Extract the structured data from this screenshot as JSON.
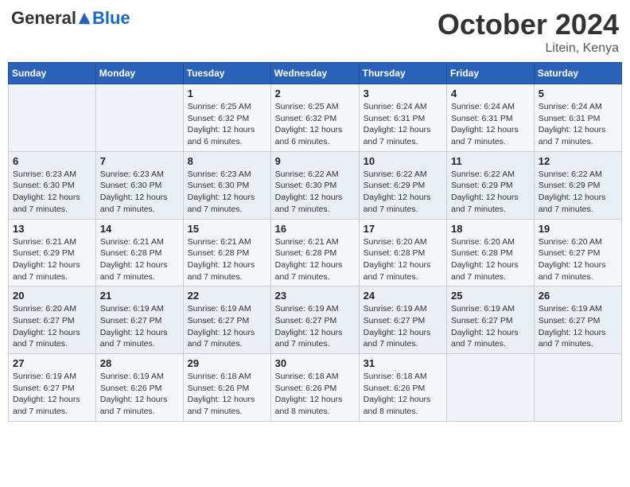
{
  "logo": {
    "general": "General",
    "blue": "Blue"
  },
  "title": {
    "month": "October 2024",
    "location": "Litein, Kenya"
  },
  "days_of_week": [
    "Sunday",
    "Monday",
    "Tuesday",
    "Wednesday",
    "Thursday",
    "Friday",
    "Saturday"
  ],
  "weeks": [
    [
      {
        "day": "",
        "detail": ""
      },
      {
        "day": "",
        "detail": ""
      },
      {
        "day": "1",
        "detail": "Sunrise: 6:25 AM\nSunset: 6:32 PM\nDaylight: 12 hours and 6 minutes."
      },
      {
        "day": "2",
        "detail": "Sunrise: 6:25 AM\nSunset: 6:32 PM\nDaylight: 12 hours and 6 minutes."
      },
      {
        "day": "3",
        "detail": "Sunrise: 6:24 AM\nSunset: 6:31 PM\nDaylight: 12 hours and 7 minutes."
      },
      {
        "day": "4",
        "detail": "Sunrise: 6:24 AM\nSunset: 6:31 PM\nDaylight: 12 hours and 7 minutes."
      },
      {
        "day": "5",
        "detail": "Sunrise: 6:24 AM\nSunset: 6:31 PM\nDaylight: 12 hours and 7 minutes."
      }
    ],
    [
      {
        "day": "6",
        "detail": "Sunrise: 6:23 AM\nSunset: 6:30 PM\nDaylight: 12 hours and 7 minutes."
      },
      {
        "day": "7",
        "detail": "Sunrise: 6:23 AM\nSunset: 6:30 PM\nDaylight: 12 hours and 7 minutes."
      },
      {
        "day": "8",
        "detail": "Sunrise: 6:23 AM\nSunset: 6:30 PM\nDaylight: 12 hours and 7 minutes."
      },
      {
        "day": "9",
        "detail": "Sunrise: 6:22 AM\nSunset: 6:30 PM\nDaylight: 12 hours and 7 minutes."
      },
      {
        "day": "10",
        "detail": "Sunrise: 6:22 AM\nSunset: 6:29 PM\nDaylight: 12 hours and 7 minutes."
      },
      {
        "day": "11",
        "detail": "Sunrise: 6:22 AM\nSunset: 6:29 PM\nDaylight: 12 hours and 7 minutes."
      },
      {
        "day": "12",
        "detail": "Sunrise: 6:22 AM\nSunset: 6:29 PM\nDaylight: 12 hours and 7 minutes."
      }
    ],
    [
      {
        "day": "13",
        "detail": "Sunrise: 6:21 AM\nSunset: 6:29 PM\nDaylight: 12 hours and 7 minutes."
      },
      {
        "day": "14",
        "detail": "Sunrise: 6:21 AM\nSunset: 6:28 PM\nDaylight: 12 hours and 7 minutes."
      },
      {
        "day": "15",
        "detail": "Sunrise: 6:21 AM\nSunset: 6:28 PM\nDaylight: 12 hours and 7 minutes."
      },
      {
        "day": "16",
        "detail": "Sunrise: 6:21 AM\nSunset: 6:28 PM\nDaylight: 12 hours and 7 minutes."
      },
      {
        "day": "17",
        "detail": "Sunrise: 6:20 AM\nSunset: 6:28 PM\nDaylight: 12 hours and 7 minutes."
      },
      {
        "day": "18",
        "detail": "Sunrise: 6:20 AM\nSunset: 6:28 PM\nDaylight: 12 hours and 7 minutes."
      },
      {
        "day": "19",
        "detail": "Sunrise: 6:20 AM\nSunset: 6:27 PM\nDaylight: 12 hours and 7 minutes."
      }
    ],
    [
      {
        "day": "20",
        "detail": "Sunrise: 6:20 AM\nSunset: 6:27 PM\nDaylight: 12 hours and 7 minutes."
      },
      {
        "day": "21",
        "detail": "Sunrise: 6:19 AM\nSunset: 6:27 PM\nDaylight: 12 hours and 7 minutes."
      },
      {
        "day": "22",
        "detail": "Sunrise: 6:19 AM\nSunset: 6:27 PM\nDaylight: 12 hours and 7 minutes."
      },
      {
        "day": "23",
        "detail": "Sunrise: 6:19 AM\nSunset: 6:27 PM\nDaylight: 12 hours and 7 minutes."
      },
      {
        "day": "24",
        "detail": "Sunrise: 6:19 AM\nSunset: 6:27 PM\nDaylight: 12 hours and 7 minutes."
      },
      {
        "day": "25",
        "detail": "Sunrise: 6:19 AM\nSunset: 6:27 PM\nDaylight: 12 hours and 7 minutes."
      },
      {
        "day": "26",
        "detail": "Sunrise: 6:19 AM\nSunset: 6:27 PM\nDaylight: 12 hours and 7 minutes."
      }
    ],
    [
      {
        "day": "27",
        "detail": "Sunrise: 6:19 AM\nSunset: 6:27 PM\nDaylight: 12 hours and 7 minutes."
      },
      {
        "day": "28",
        "detail": "Sunrise: 6:19 AM\nSunset: 6:26 PM\nDaylight: 12 hours and 7 minutes."
      },
      {
        "day": "29",
        "detail": "Sunrise: 6:18 AM\nSunset: 6:26 PM\nDaylight: 12 hours and 7 minutes."
      },
      {
        "day": "30",
        "detail": "Sunrise: 6:18 AM\nSunset: 6:26 PM\nDaylight: 12 hours and 8 minutes."
      },
      {
        "day": "31",
        "detail": "Sunrise: 6:18 AM\nSunset: 6:26 PM\nDaylight: 12 hours and 8 minutes."
      },
      {
        "day": "",
        "detail": ""
      },
      {
        "day": "",
        "detail": ""
      }
    ]
  ]
}
